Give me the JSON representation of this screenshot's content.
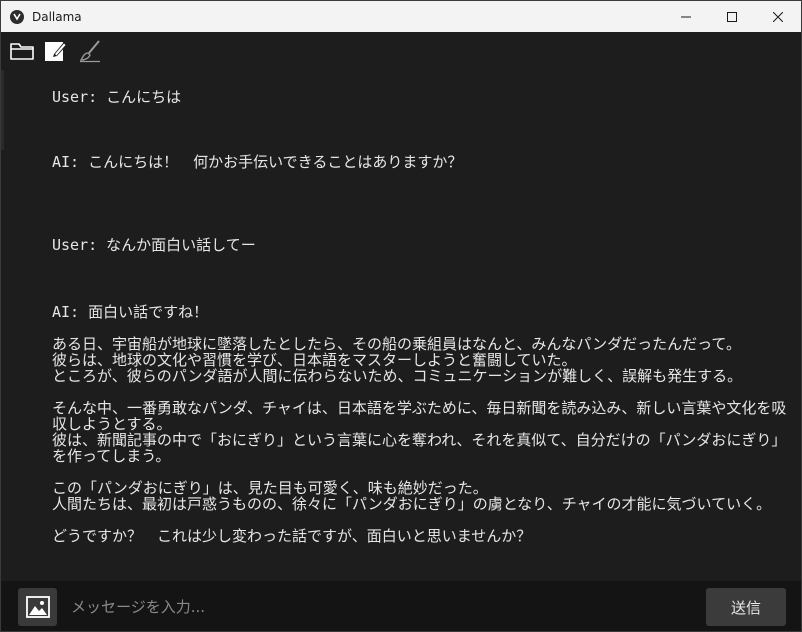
{
  "window": {
    "title": "Dallama"
  },
  "toolbar": {
    "icons": [
      "folder-icon",
      "edit-icon",
      "brush-icon"
    ]
  },
  "messages": [
    {
      "role": "user",
      "text": "User: こんにちは"
    },
    {
      "role": "ai",
      "text": "AI: こんにちは！　何かお手伝いできることはありますか？"
    },
    {
      "role": "user",
      "text": "User: なんか面白い話してー"
    },
    {
      "role": "ai",
      "text": "AI: 面白い話ですね！\n\nある日、宇宙船が地球に墜落したとしたら、その船の乗組員はなんと、みんなパンダだったんだって。\n彼らは、地球の文化や習慣を学び、日本語をマスターしようと奮闘していた。\nところが、彼らのパンダ語が人間に伝わらないため、コミュニケーションが難しく、誤解も発生する。\n\nそんな中、一番勇敢なパンダ、チャイは、日本語を学ぶために、毎日新聞を読み込み、新しい言葉や文化を吸収しようとする。\n彼は、新聞記事の中で「おにぎり」という言葉に心を奪われ、それを真似て、自分だけの「パンダおにぎり」を作ってしまう。\n\nこの「パンダおにぎり」は、見た目も可愛く、味も絶妙だった。\n人間たちは、最初は戸惑うものの、徐々に「パンダおにぎり」の虜となり、チャイの才能に気づいていく。\n\nどうですか？　これは少し変わった話ですが、面白いと思いませんか？"
    }
  ],
  "input": {
    "placeholder": "メッセージを入力...",
    "value": ""
  },
  "send_button": {
    "label": "送信"
  },
  "colors": {
    "background": "#1d1d1d",
    "input_bar": "#141414",
    "button": "#3b3b3b",
    "text": "#e6e6e6",
    "titlebar": "#f3f3f3"
  }
}
